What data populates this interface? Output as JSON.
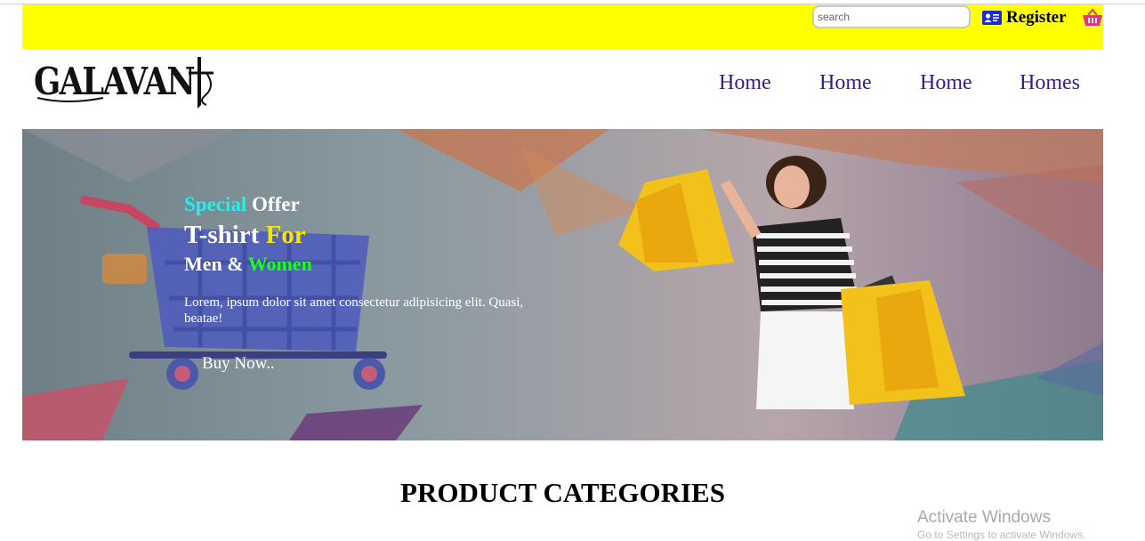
{
  "header": {
    "search_placeholder": "search",
    "register_label": "Register"
  },
  "logo": {
    "text": "GALAVANT"
  },
  "nav": {
    "items": [
      "Home",
      "Home",
      "Home",
      "Homes"
    ]
  },
  "hero": {
    "line1_a": "Special",
    "line1_b": " Offer",
    "line2_a": "T-shirt ",
    "line2_b": "For",
    "line3_a": "Men & ",
    "line3_b": "Women",
    "description": "Lorem, ipsum dolor sit amet consectetur adipisicing elit. Quasi, beatae!",
    "button_label": "Buy Now.."
  },
  "section": {
    "title": "PRODUCT CATEGORIES"
  },
  "watermark": {
    "line1": "Activate Windows",
    "line2": "Go to Settings to activate Windows."
  },
  "colors": {
    "topbar": "#ffff00",
    "nav": "#3a1a8a",
    "accent_cyan": "#22f0ee",
    "accent_yellow": "#ffe600",
    "accent_green": "#1aff1a",
    "cart": "#e8318a"
  },
  "icons": [
    "contact-card-icon",
    "shopping-basket-icon"
  ]
}
